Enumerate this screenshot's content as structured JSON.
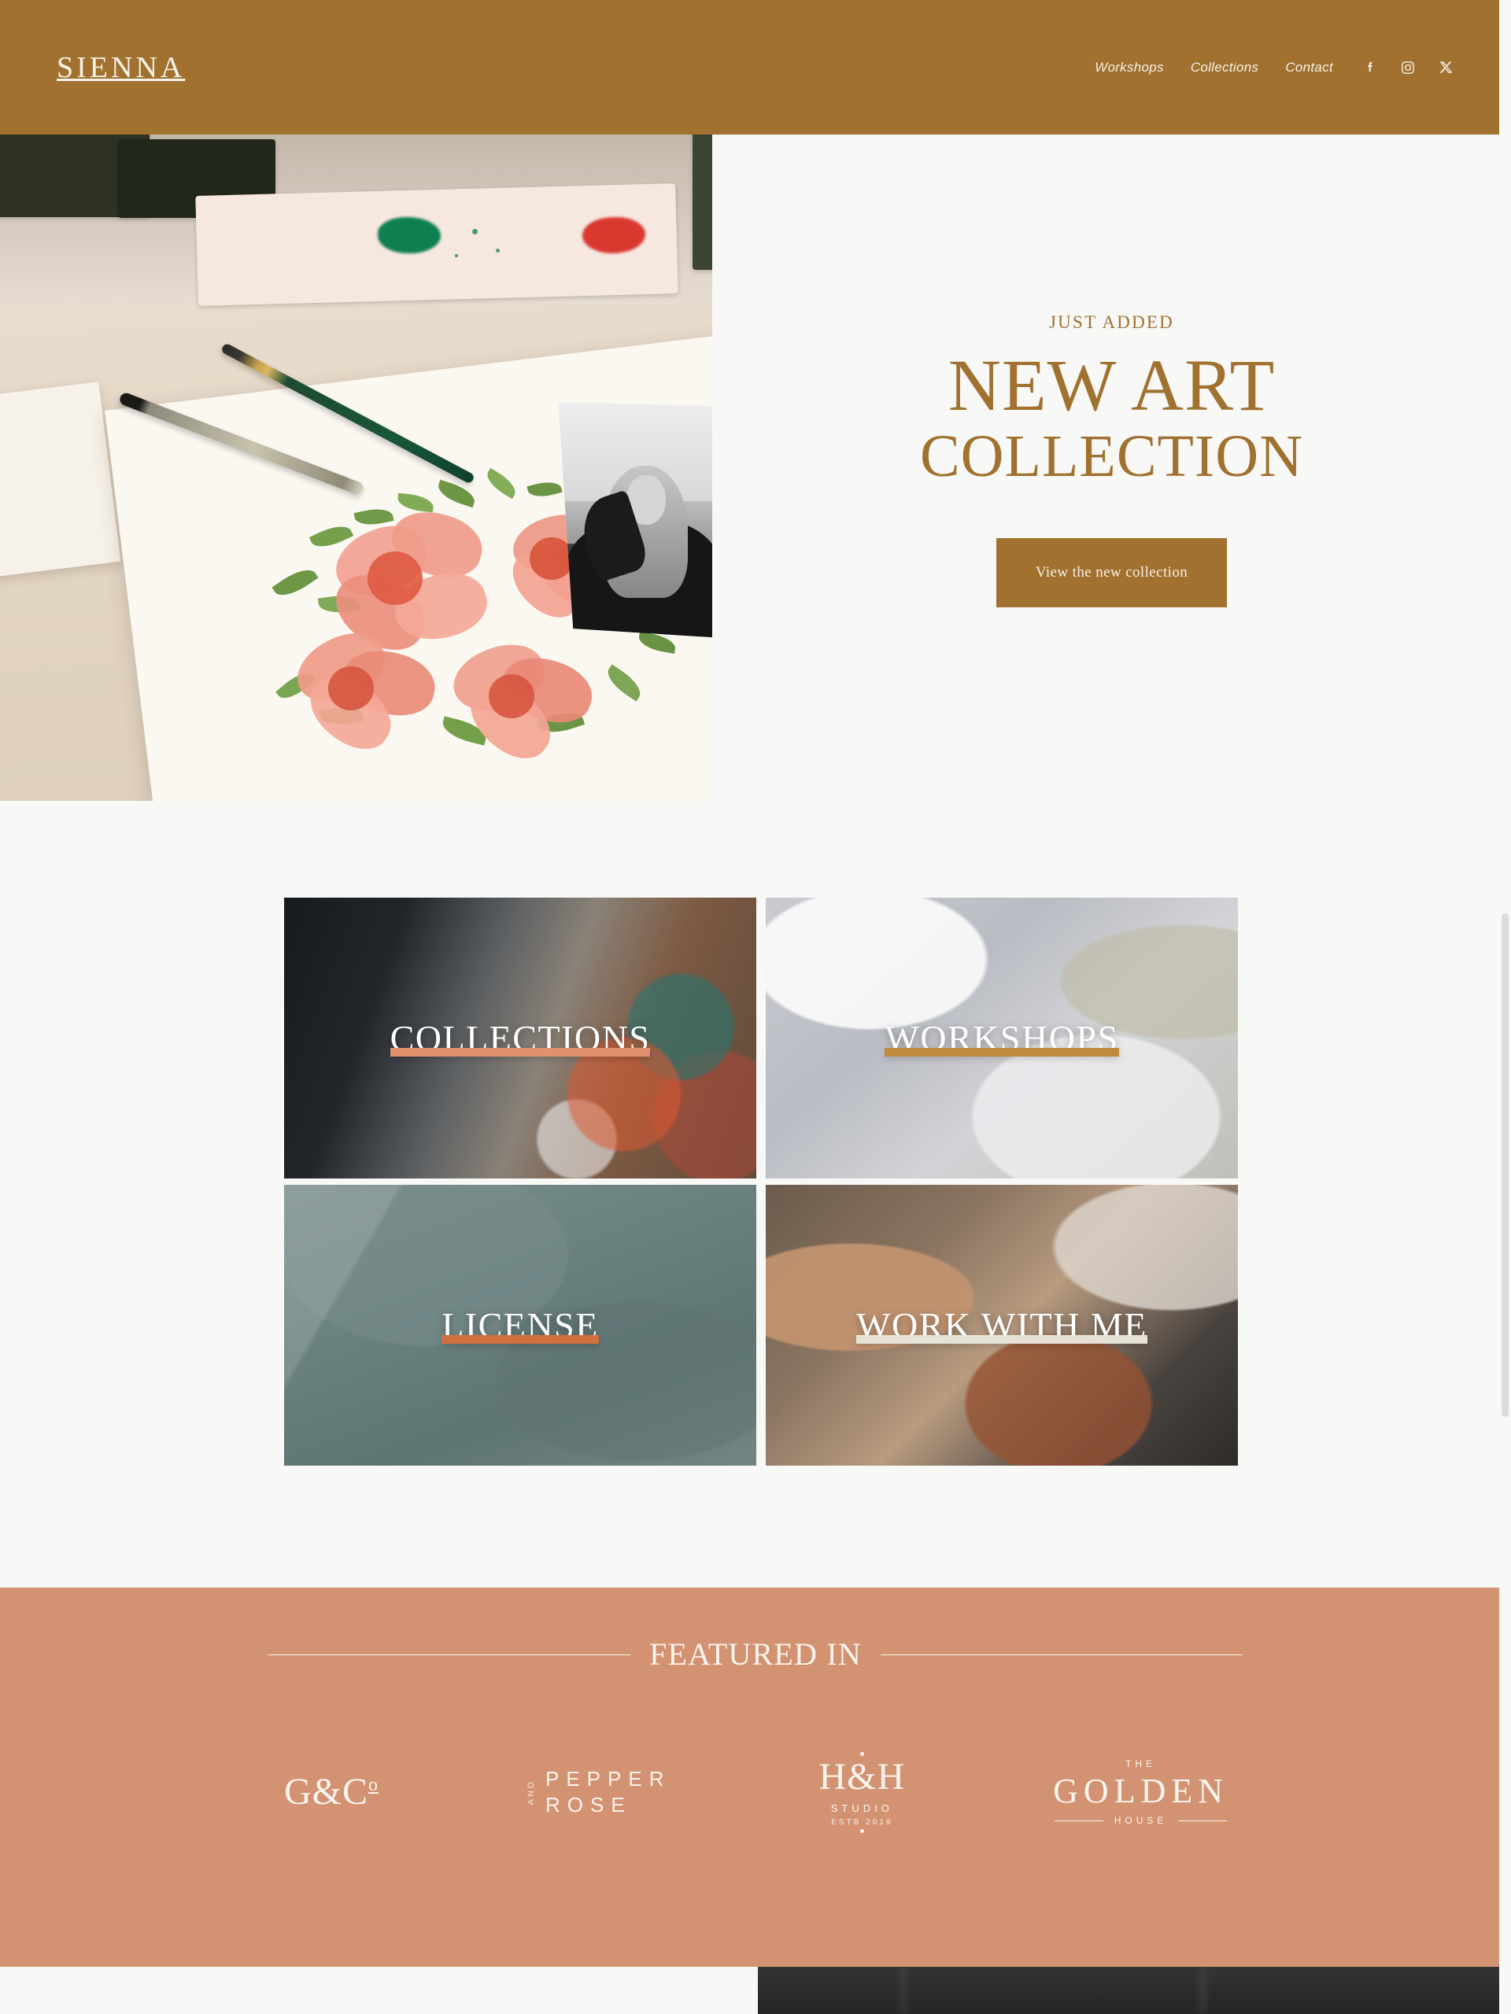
{
  "header": {
    "logo": "SIENNA",
    "nav": [
      {
        "label": "Workshops"
      },
      {
        "label": "Collections"
      },
      {
        "label": "Contact"
      }
    ],
    "social": [
      {
        "name": "facebook-icon",
        "label": "Facebook"
      },
      {
        "name": "instagram-icon",
        "label": "Instagram"
      },
      {
        "name": "x-icon",
        "label": "X"
      }
    ],
    "bg_color": "#a0712f",
    "text_color": "#f7f2e8"
  },
  "hero": {
    "eyebrow": "JUST ADDED",
    "title_line1": "NEW ART",
    "title_line2": "COLLECTION",
    "cta_label": "View the new collection",
    "accent_color": "#a0712f",
    "bg_color": "#f8f8f7"
  },
  "tiles": [
    {
      "label": "COLLECTIONS",
      "underline_color": "#e0926c"
    },
    {
      "label": "WORKSHOPS",
      "underline_color": "#c08a3e"
    },
    {
      "label": "LICENSE",
      "underline_color": "#d1703f"
    },
    {
      "label": "WORK WITH ME",
      "underline_color": "#e6e2d8"
    }
  ],
  "featured": {
    "title": "FEATURED IN",
    "bg_color": "#d39372",
    "text_color": "#faf4ee",
    "brands": [
      {
        "id": "g-and-co",
        "main": "G&C",
        "sup": "o"
      },
      {
        "id": "pepper-and-rose",
        "and": "AND",
        "word1": "PEPPER",
        "word2": "ROSE"
      },
      {
        "id": "h-and-h-studio",
        "main": "H&H",
        "sub": "STUDIO",
        "established": "ESTB 2019"
      },
      {
        "id": "the-golden-house",
        "the": "THE",
        "main": "GOLDEN",
        "house": "HOUSE"
      }
    ]
  }
}
